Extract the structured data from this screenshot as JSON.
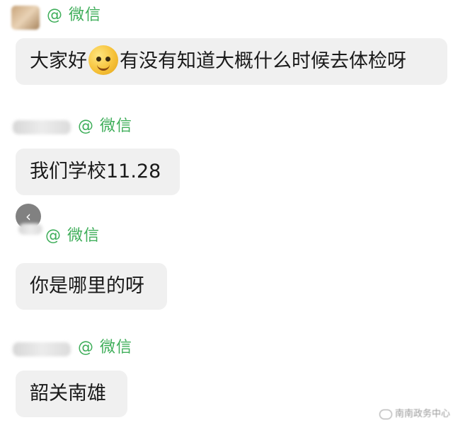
{
  "messages": [
    {
      "sender_tag": "@ 微信",
      "text_before": "大家好",
      "emoji": "grin-emoji-icon",
      "text_after": "有没有知道大概什么时候去体检呀"
    },
    {
      "sender_tag": "@ 微信",
      "text": "我们学校11.28"
    },
    {
      "sender_tag": "@ 微信",
      "text": "你是哪里的呀"
    },
    {
      "sender_tag": "@ 微信",
      "text": "韶关南雄"
    }
  ],
  "back_button": {
    "icon": "chevron-left-icon",
    "glyph": "‹"
  },
  "watermark": {
    "icon": "wechat-channel-icon",
    "text": "南南政务中心"
  },
  "colors": {
    "bubble": "#f0f0f0",
    "wechat_tag": "#3fae5a",
    "text": "#1a1a1a"
  }
}
